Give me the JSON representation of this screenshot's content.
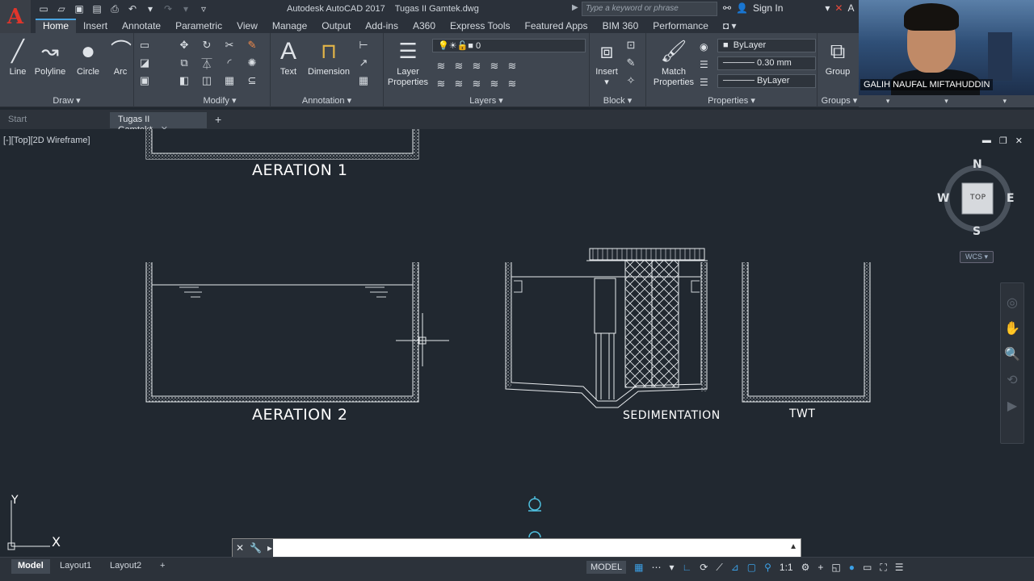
{
  "app": {
    "logo": "A",
    "title": "Autodesk AutoCAD 2017",
    "filename": "Tugas II Gamtek.dwg",
    "search_placeholder": "Type a keyword or phrase",
    "sign_in": "Sign In"
  },
  "menu_tabs": [
    "Home",
    "Insert",
    "Annotate",
    "Parametric",
    "View",
    "Manage",
    "Output",
    "Add-ins",
    "A360",
    "Express Tools",
    "Featured Apps",
    "BIM 360",
    "Performance"
  ],
  "ribbon": {
    "draw": {
      "title": "Draw",
      "tools": [
        "Line",
        "Polyline",
        "Circle",
        "Arc"
      ]
    },
    "modify": {
      "title": "Modify"
    },
    "annotation": {
      "title": "Annotation",
      "tools": [
        "Text",
        "Dimension"
      ]
    },
    "layers": {
      "title": "Layers",
      "layer_properties": "Layer\nProperties",
      "current_layer": "0"
    },
    "block": {
      "title": "Block",
      "insert": "Insert"
    },
    "properties": {
      "title": "Properties",
      "match": "Match\nProperties",
      "color": "ByLayer",
      "lineweight": "0.30 mm",
      "linetype": "ByLayer"
    },
    "groups": {
      "title": "Groups",
      "group": "Group"
    }
  },
  "doc_tabs": {
    "start": "Start",
    "current": "Tugas II Gamtek*"
  },
  "viewport": {
    "label": "[-][Top][2D Wireframe]",
    "labels": {
      "aeration1": "AERATION 1",
      "aeration2": "AERATION 2",
      "sedimentation": "SEDIMENTATION",
      "twt": "TWT"
    },
    "viewcube": {
      "n": "N",
      "s": "S",
      "e": "E",
      "w": "W",
      "face": "TOP",
      "wcs": "WCS"
    },
    "ucs": {
      "x": "X",
      "y": "Y"
    }
  },
  "command_line": {
    "prompt": ""
  },
  "layout_tabs": [
    "Model",
    "Layout1",
    "Layout2"
  ],
  "status": {
    "model": "MODEL",
    "scale": "1:1"
  },
  "webcam": {
    "name": "GALIH NAUFAL MIFTAHUDDIN"
  }
}
